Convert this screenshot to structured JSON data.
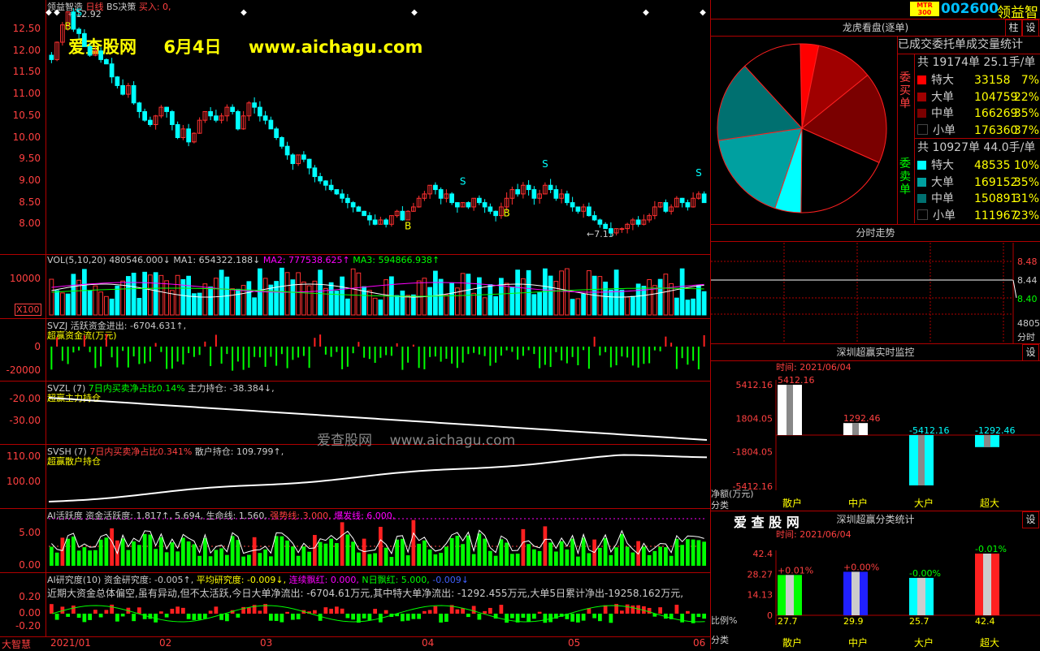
{
  "kline": {
    "name": "领益智造",
    "period": "日线",
    "strategy": "BS决策",
    "buy_label": "买入: 0,",
    "high_note": "12.92",
    "low_note": "7.15",
    "watermark_site": "爱查股网",
    "watermark_date": "6月4日",
    "watermark_url": "www.aichagu.com",
    "ticks": [
      "12.50",
      "12.00",
      "11.50",
      "11.00",
      "10.50",
      "10.00",
      "9.50",
      "9.00",
      "8.50",
      "8.00"
    ],
    "bs": [
      {
        "label": "B",
        "i": 3
      },
      {
        "label": "S",
        "i": 5
      },
      {
        "label": "B",
        "i": 65
      },
      {
        "label": "S",
        "i": 75
      },
      {
        "label": "B",
        "i": 83
      },
      {
        "label": "S",
        "i": 90
      },
      {
        "label": "S",
        "i": 118
      }
    ],
    "closes": [
      11.8,
      12.2,
      12.6,
      12.9,
      12.5,
      12.4,
      12.1,
      11.9,
      12.0,
      11.8,
      11.7,
      11.4,
      11.2,
      11.0,
      11.2,
      10.8,
      10.6,
      10.4,
      10.3,
      10.5,
      10.7,
      10.6,
      10.3,
      10.0,
      10.2,
      9.9,
      10.1,
      10.4,
      10.6,
      10.5,
      10.4,
      10.5,
      10.7,
      10.6,
      10.2,
      10.5,
      10.8,
      10.7,
      10.5,
      10.4,
      10.2,
      10.0,
      9.8,
      9.6,
      9.4,
      9.6,
      9.5,
      9.3,
      9.1,
      9.0,
      8.9,
      8.8,
      8.7,
      8.6,
      8.5,
      8.4,
      8.3,
      8.2,
      8.1,
      8.0,
      8.1,
      8.0,
      8.2,
      8.3,
      8.1,
      8.3,
      8.4,
      8.6,
      8.7,
      8.9,
      8.8,
      8.6,
      8.7,
      8.5,
      8.4,
      8.5,
      8.4,
      8.6,
      8.5,
      8.4,
      8.3,
      8.2,
      8.4,
      8.6,
      8.8,
      8.7,
      8.9,
      8.8,
      8.6,
      8.7,
      8.9,
      8.8,
      8.6,
      8.7,
      8.5,
      8.4,
      8.3,
      8.4,
      8.2,
      8.1,
      8.0,
      7.9,
      7.8,
      7.9,
      7.9,
      8.0,
      8.1,
      8.0,
      8.1,
      8.2,
      8.4,
      8.5,
      8.3,
      8.4,
      8.6,
      8.5,
      8.4,
      8.6,
      8.7,
      8.5
    ]
  },
  "vol": {
    "title": "VOL(5,10,20)",
    "value": "480546.000↓",
    "ma1": "MA1: 654322.188↓",
    "ma2": "MA2: 777538.625↑",
    "ma3": "MA3: 594866.938↑",
    "ticks": [
      "10000"
    ],
    "unit": "X100"
  },
  "svzj": {
    "title": "SVZJ",
    "desc": "活跃资金进出: -6704.631↑,",
    "sub": "超赢资金流(万元)",
    "ticks": [
      "0",
      "-20000"
    ]
  },
  "svzl": {
    "title": "SVZL (7)",
    "desc1": "7日内买卖净占比0.14%",
    "desc2": "主力持仓: -38.384↓,",
    "sub": "超赢主力持仓",
    "ticks": [
      "-20.00",
      "-30.00"
    ]
  },
  "svsh": {
    "title": "SVSH (7)",
    "desc1": "7日内买卖净占比0.341%",
    "desc2": "散户持仓: 109.799↑,",
    "sub": "超赢散户持仓",
    "ticks": [
      "110.00",
      "100.00"
    ]
  },
  "ai1": {
    "title": "AI活跃度",
    "a": "资金活跃度: 1.817↑, 5.694,",
    "b": "生命线: 1.560,",
    "c": "强势线: 3.000,",
    "d": "爆发线: 6.000,",
    "ticks": [
      "5.00",
      "0.00"
    ]
  },
  "ai2": {
    "title": "AI研究度(10)",
    "a": "资金研究度: -0.005↑,",
    "b": "平均研究度: -0.009↓,",
    "c": "连续飘红: 0.000,",
    "d": "N日飘红: 5.000,",
    "e": "-0.009↓",
    "note": "近期大资金总体偏空,虽有异动,但不太活跃,今日大单净流出: -6704.61万元,其中特大单净流出: -1292.455万元,大单5日累计净出-19258.162万元,",
    "ticks": [
      "0.20",
      "0.00",
      "-0.20"
    ]
  },
  "watermark2": "爱查股网    www.aichagu.com",
  "xaxis": {
    "brand": "大智慧",
    "labels": [
      "2021/01",
      "02",
      "03",
      "04",
      "05",
      "06"
    ]
  },
  "header": {
    "logo": "MTR 300",
    "code": "002600",
    "name": "领益智",
    "btn1": "柱",
    "btn2": "设"
  },
  "pie": {
    "title": "龙虎看盘(逐单)",
    "subtitle": "已成交委托单成交量统计"
  },
  "buy": {
    "side": "委买单",
    "total": "共 19174单 25.1手/单",
    "rows": [
      {
        "label": "特大",
        "value": "33158",
        "pct": "7%",
        "color": "#ff0000"
      },
      {
        "label": "大单",
        "value": "104759",
        "pct": "22%",
        "color": "#a00000"
      },
      {
        "label": "中单",
        "value": "166269",
        "pct": "35%",
        "color": "#7a0000"
      },
      {
        "label": "小单",
        "value": "176360",
        "pct": "37%",
        "color": "#000000"
      }
    ]
  },
  "sell": {
    "side": "委卖单",
    "total": "共 10927单 44.0手/单",
    "rows": [
      {
        "label": "特大",
        "value": "48535",
        "pct": "10%",
        "color": "#00ffff"
      },
      {
        "label": "大单",
        "value": "169152",
        "pct": "35%",
        "color": "#00a0a0"
      },
      {
        "label": "中单",
        "value": "150891",
        "pct": "31%",
        "color": "#007070"
      },
      {
        "label": "小单",
        "value": "111967",
        "pct": "23%",
        "color": "#000000"
      }
    ]
  },
  "fenshi": {
    "title": "分时走势",
    "ticks": [
      "8.48",
      "8.44",
      "8.40"
    ],
    "vol": "48054",
    "vol_label": "分时"
  },
  "monitor": {
    "title": "深圳超赢实时监控",
    "time": "时间: 2021/06/04",
    "ticks": [
      "5412.16",
      "1804.05",
      "-1804.05",
      "-5412.16"
    ],
    "bars": [
      {
        "label": "5412.16",
        "value": 5412.16
      },
      {
        "label": "1292.46",
        "value": 1292.46
      },
      {
        "label": "-5412.16",
        "value": -5412.16
      },
      {
        "label": "-1292.46",
        "value": -1292.46
      }
    ],
    "ylabel": "净额(万元)",
    "xlabel": "分类",
    "cats": [
      "散户",
      "中户",
      "大户",
      "超大"
    ]
  },
  "classstat": {
    "brand": "爱 查 股 网",
    "title": "深圳超赢分类统计",
    "time": "时间: 2021/06/04",
    "ticks": [
      "42.4",
      "28.27",
      "14.13",
      "0"
    ],
    "bars": [
      {
        "top": "+0.01%",
        "value": 27.7,
        "bottom": "27.7"
      },
      {
        "top": "+0.00%",
        "value": 29.9,
        "bottom": "29.9"
      },
      {
        "top": "-0.00%",
        "value": 25.7,
        "bottom": "25.7"
      },
      {
        "top": "-0.01%",
        "value": 42.4,
        "bottom": "42.4"
      }
    ],
    "ylabel": "比例%",
    "xlabel": "分类",
    "cats": [
      "散户",
      "中户",
      "大户",
      "超大"
    ]
  }
}
